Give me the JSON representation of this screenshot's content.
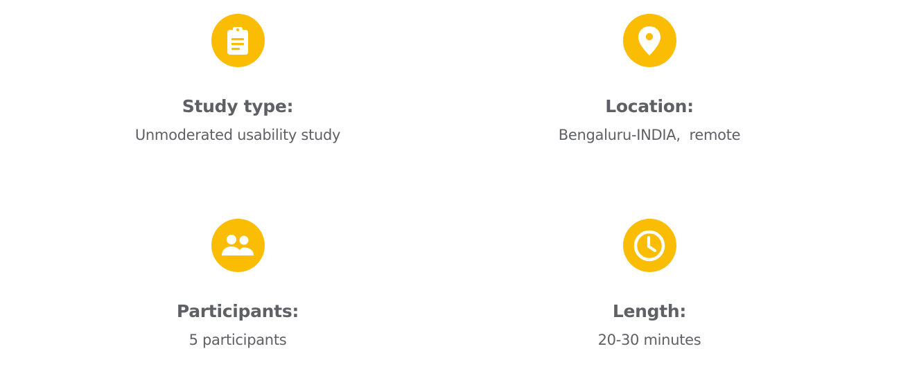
{
  "colors": {
    "accent": "#fbbc04",
    "text": "#5f6066",
    "background": "#ffffff"
  },
  "items": [
    {
      "icon": "clipboard-icon",
      "label": "Study type:",
      "value": "Unmoderated usability study"
    },
    {
      "icon": "location-pin-icon",
      "label": "Location:",
      "value": "Bengaluru-INDIA,  remote"
    },
    {
      "icon": "people-icon",
      "label": "Participants:",
      "value": "5 participants"
    },
    {
      "icon": "clock-icon",
      "label": "Length:",
      "value": "20-30 minutes"
    }
  ]
}
